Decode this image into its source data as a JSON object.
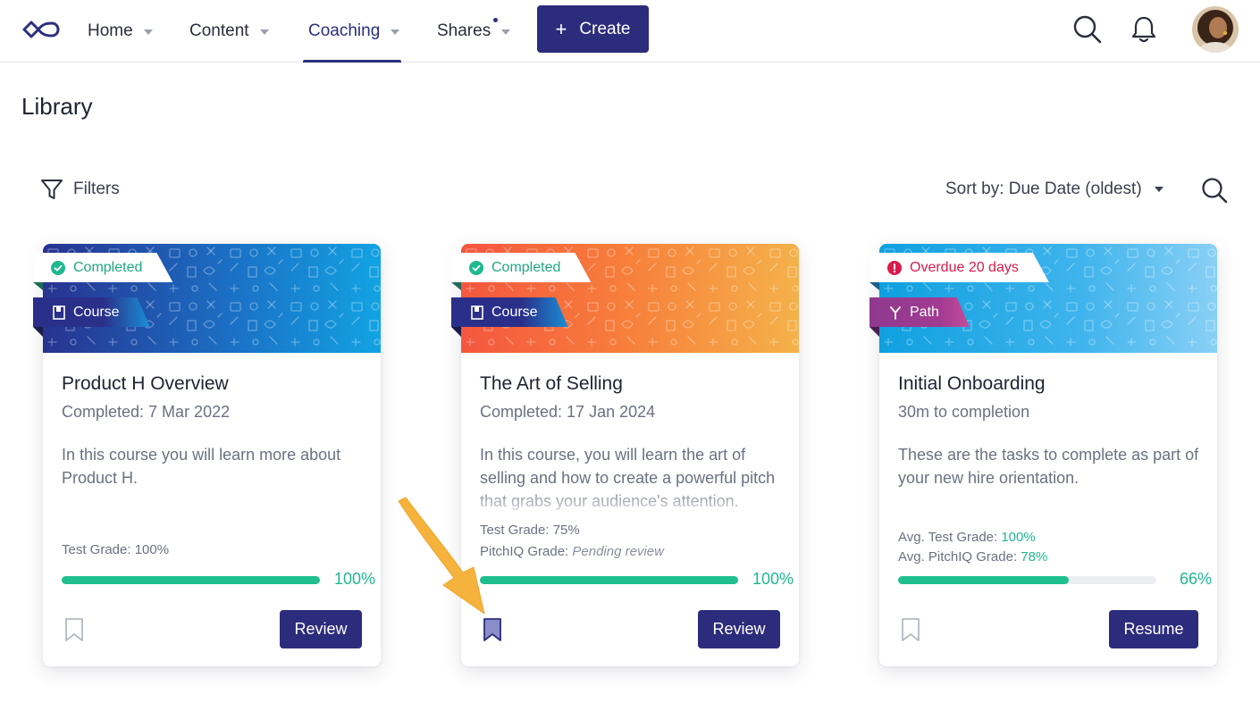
{
  "nav": {
    "items": [
      {
        "label": "Home"
      },
      {
        "label": "Content"
      },
      {
        "label": "Coaching"
      },
      {
        "label": "Shares"
      }
    ],
    "active": "Coaching",
    "create_label": "Create",
    "plus": "+"
  },
  "page": {
    "title": "Library",
    "filters_label": "Filters",
    "sort_label": "Sort by: Due Date (oldest)"
  },
  "cards": [
    {
      "status": "Completed",
      "type": "Course",
      "title": "Product H Overview",
      "subtitle": "Completed: 7 Mar 2022",
      "description": "In this course you will learn more about Product H.",
      "grades": [
        {
          "label": "Test Grade: 100%"
        }
      ],
      "progress": 100,
      "progress_label": "100%",
      "bookmarked": false,
      "action": "Review"
    },
    {
      "status": "Completed",
      "type": "Course",
      "title": "The Art of Selling",
      "subtitle": "Completed: 17 Jan 2024",
      "description": "In this course, you will learn the art of selling and how to create a powerful pitch that grabs your audience's attention.",
      "grades": [
        {
          "label": "Test Grade: 75%"
        },
        {
          "label": "PitchIQ Grade: ",
          "value": "Pending review"
        }
      ],
      "progress": 100,
      "progress_label": "100%",
      "bookmarked": true,
      "action": "Review"
    },
    {
      "status": "Overdue 20 days",
      "type": "Path",
      "title": "Initial Onboarding",
      "subtitle": "30m to completion",
      "description": "These are the tasks to complete as part of your new hire orientation.",
      "grades": [
        {
          "label": "Avg. Test Grade: ",
          "value": "100%"
        },
        {
          "label": "Avg. PitchIQ Grade: ",
          "value": "78%"
        }
      ],
      "progress": 66,
      "progress_label": "66%",
      "bookmarked": false,
      "action": "Resume"
    }
  ],
  "colors": {
    "primary": "#2c2c7c",
    "success": "#1fbf8f",
    "overdue": "#d81b4a",
    "course_tag": "#2a2f8a",
    "path_tag": "#8e3a8f"
  },
  "icons": {
    "logo": "infinity-logo-icon",
    "search": "search-icon",
    "notifications": "bell-icon",
    "filter": "filter-icon",
    "bookmark": "bookmark-icon",
    "completed": "check-circle-icon",
    "overdue": "alert-circle-icon",
    "course": "book-icon",
    "path": "fork-icon",
    "annotation": "arrow-pointer-icon"
  }
}
